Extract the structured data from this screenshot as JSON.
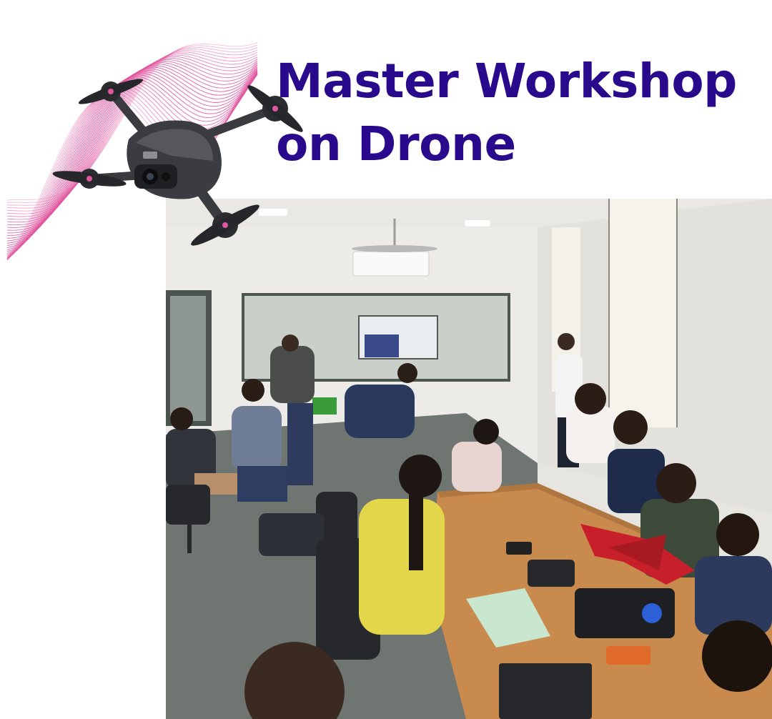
{
  "title": {
    "line1": "Master Workshop",
    "line2": "on Drone"
  },
  "colors": {
    "title": "#2a0a8c",
    "wave": "#e0569f",
    "drone_body": "#3a3b3f",
    "table": "#c98a4e",
    "yellow_shirt": "#e4d64a",
    "floor": "#6f7570",
    "walls": "#ecebe7"
  },
  "icons": {
    "drone": "drone-icon",
    "wave": "wave-lines-decoration"
  }
}
